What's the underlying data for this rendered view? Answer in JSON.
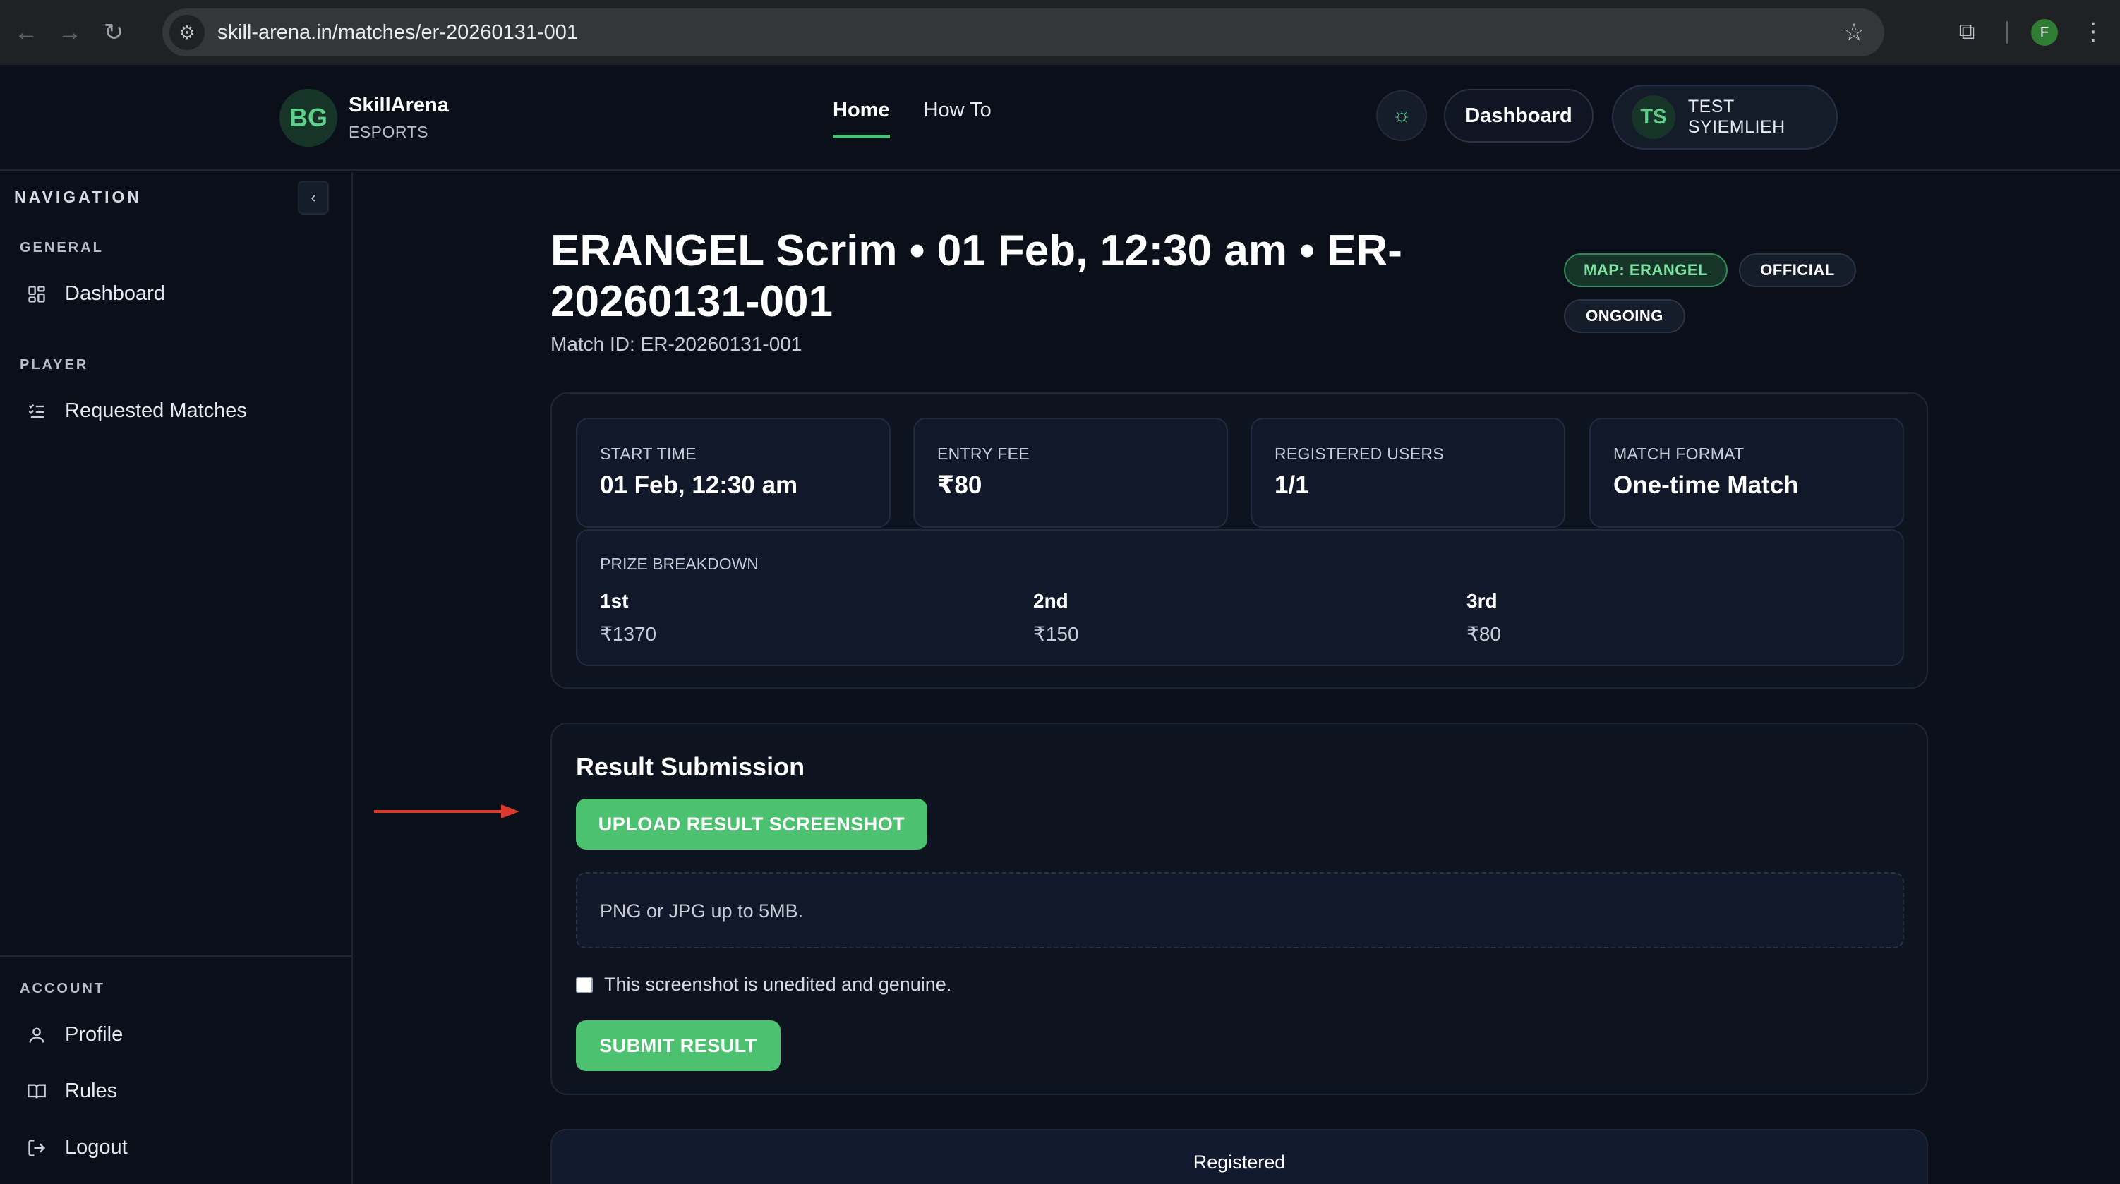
{
  "browser": {
    "url": "skill-arena.in/matches/er-20260131-001",
    "profile_initial": "F"
  },
  "header": {
    "logo_initials": "BG",
    "brand_name": "SkillArena",
    "brand_sub": "ESPORTS",
    "nav": [
      {
        "label": "Home",
        "active": true
      },
      {
        "label": "How To",
        "active": false
      }
    ],
    "dashboard_label": "Dashboard",
    "user_initials": "TS",
    "user_name": "TEST SYIEMLIEH"
  },
  "sidebar": {
    "title": "NAVIGATION",
    "collapse_glyph": "‹",
    "general_label": "GENERAL",
    "player_label": "PLAYER",
    "account_label": "ACCOUNT",
    "items": {
      "dashboard": "Dashboard",
      "requested_matches": "Requested Matches",
      "profile": "Profile",
      "rules": "Rules",
      "logout": "Logout"
    }
  },
  "match": {
    "title": "ERANGEL Scrim • 01 Feb, 12:30 am • ER-20260131-001",
    "match_id": "Match ID: ER-20260131-001",
    "badges": {
      "map": "MAP: ERANGEL",
      "official": "OFFICIAL",
      "status": "ONGOING"
    },
    "stats": [
      {
        "label": "START TIME",
        "value": "01 Feb, 12:30 am"
      },
      {
        "label": "ENTRY FEE",
        "value": "₹80"
      },
      {
        "label": "REGISTERED USERS",
        "value": "1/1"
      },
      {
        "label": "MATCH FORMAT",
        "value": "One-time Match"
      }
    ],
    "prize_label": "PRIZE BREAKDOWN",
    "prizes": [
      {
        "place": "1st",
        "amount": "₹1370"
      },
      {
        "place": "2nd",
        "amount": "₹150"
      },
      {
        "place": "3rd",
        "amount": "₹80"
      }
    ]
  },
  "result": {
    "heading": "Result Submission",
    "upload_label": "UPLOAD RESULT SCREENSHOT",
    "hint": "PNG or JPG up to 5MB.",
    "checkbox_label": "This screenshot is unedited and genuine.",
    "checkbox_checked": false,
    "submit_label": "SUBMIT RESULT"
  },
  "registered_label": "Registered",
  "colors": {
    "accent": "#4cc16f",
    "background": "#0b0f1a",
    "annotation_arrow": "#d93a2b"
  }
}
